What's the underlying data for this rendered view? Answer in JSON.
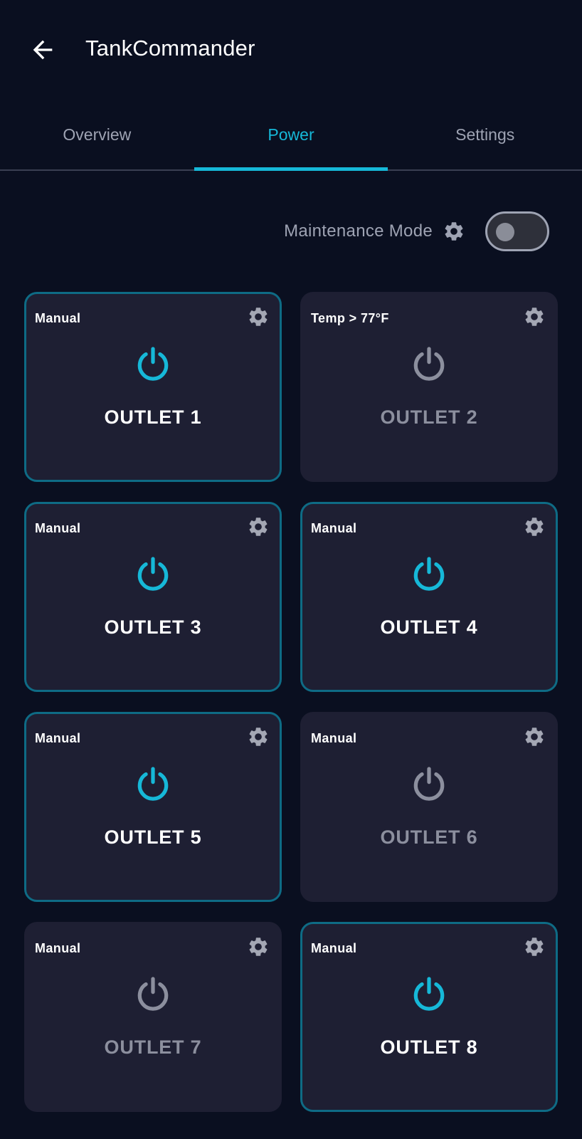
{
  "header": {
    "title": "TankCommander"
  },
  "tabs": [
    {
      "label": "Overview",
      "active": false
    },
    {
      "label": "Power",
      "active": true
    },
    {
      "label": "Settings",
      "active": false
    }
  ],
  "maintenance": {
    "label": "Maintenance Mode",
    "enabled": false
  },
  "outlets": [
    {
      "name": "OUTLET 1",
      "mode": "Manual",
      "on": true
    },
    {
      "name": "OUTLET 2",
      "mode": "Temp > 77°F",
      "on": false
    },
    {
      "name": "OUTLET 3",
      "mode": "Manual",
      "on": true
    },
    {
      "name": "OUTLET 4",
      "mode": "Manual",
      "on": true
    },
    {
      "name": "OUTLET 5",
      "mode": "Manual",
      "on": true
    },
    {
      "name": "OUTLET 6",
      "mode": "Manual",
      "on": false
    },
    {
      "name": "OUTLET 7",
      "mode": "Manual",
      "on": false
    },
    {
      "name": "OUTLET 8",
      "mode": "Manual",
      "on": true
    }
  ],
  "colors": {
    "background": "#0a0f20",
    "card": "#1e1f33",
    "accent": "#16b8d8",
    "card_border_on": "#0e6b85",
    "muted": "#9ea3b3",
    "power_off": "#8c8f9e"
  },
  "icons": {
    "back": "arrow-left-icon",
    "gear": "gear-icon",
    "power": "power-icon"
  }
}
